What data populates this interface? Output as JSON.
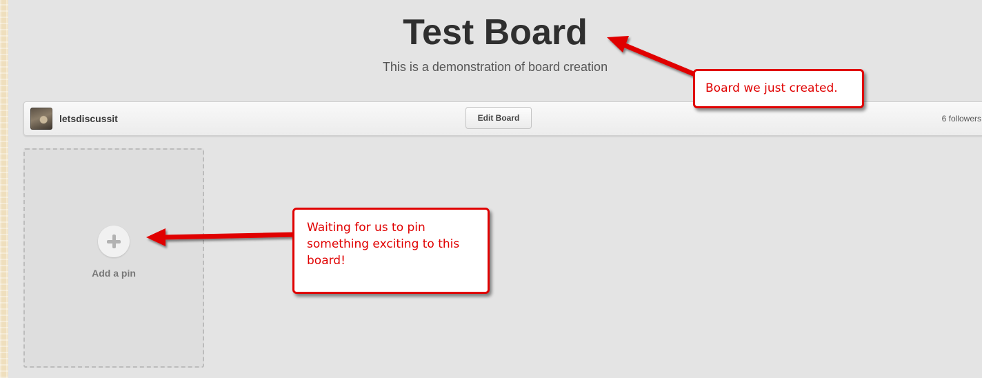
{
  "board": {
    "title": "Test Board",
    "description": "This is a demonstration of board creation",
    "owner": "letsdiscussit",
    "edit_label": "Edit Board",
    "followers": "6 followers"
  },
  "add_pin": {
    "label": "Add a pin",
    "icon": "plus-icon"
  },
  "annotations": {
    "board_created": "Board we just created.",
    "waiting": "Waiting for us to pin something exciting to this board!"
  },
  "colors": {
    "annotation": "#e00000",
    "page_background": "#e4e4e4",
    "slide_background": "#efdfbd"
  }
}
